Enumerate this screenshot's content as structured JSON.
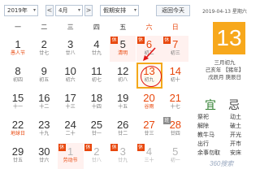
{
  "toolbar": {
    "year_value": "2019年",
    "prev_month": "<",
    "month_value": "4月",
    "next_month": ">",
    "holiday_select": "假期安排",
    "back_today": "返回今天"
  },
  "weekdays": [
    "一",
    "二",
    "三",
    "四",
    "五",
    "六",
    "日"
  ],
  "calendar": {
    "rows": [
      [
        {
          "day": "1",
          "lunar": "愚人节",
          "festival": true
        },
        {
          "day": "2",
          "lunar": "廿七"
        },
        {
          "day": "3",
          "lunar": "廿八"
        },
        {
          "day": "4",
          "lunar": "廿九"
        },
        {
          "day": "5",
          "lunar": "清明",
          "festival": true,
          "badge": "休",
          "holiday": true
        },
        {
          "day": "6",
          "lunar": "初二",
          "badge": "休",
          "holiday": true,
          "weekend": true
        },
        {
          "day": "7",
          "lunar": "初三",
          "badge": "休",
          "holiday": true,
          "weekend": true
        }
      ],
      [
        {
          "day": "8",
          "lunar": "初四"
        },
        {
          "day": "9",
          "lunar": "初五"
        },
        {
          "day": "10",
          "lunar": "初六"
        },
        {
          "day": "11",
          "lunar": "初七"
        },
        {
          "day": "12",
          "lunar": "初八"
        },
        {
          "day": "13",
          "lunar": "初九",
          "weekend": true,
          "today": true
        },
        {
          "day": "14",
          "lunar": "初十",
          "weekend": true
        }
      ],
      [
        {
          "day": "15",
          "lunar": "十一"
        },
        {
          "day": "16",
          "lunar": "十二"
        },
        {
          "day": "17",
          "lunar": "十三"
        },
        {
          "day": "18",
          "lunar": "十四"
        },
        {
          "day": "19",
          "lunar": "十五"
        },
        {
          "day": "20",
          "lunar": "谷雨",
          "festival": true,
          "weekend": true
        },
        {
          "day": "21",
          "lunar": "十七",
          "weekend": true
        }
      ],
      [
        {
          "day": "22",
          "lunar": "地球日",
          "festival": true
        },
        {
          "day": "23",
          "lunar": "十九"
        },
        {
          "day": "24",
          "lunar": "二十"
        },
        {
          "day": "25",
          "lunar": "廿一"
        },
        {
          "day": "26",
          "lunar": "廿二"
        },
        {
          "day": "27",
          "lunar": "廿三",
          "weekend": true
        },
        {
          "day": "28",
          "lunar": "廿四",
          "weekend": true,
          "badge": "班",
          "work": true
        }
      ],
      [
        {
          "day": "29",
          "lunar": "廿五"
        },
        {
          "day": "30",
          "lunar": "廿六"
        },
        {
          "day": "1",
          "lunar": "劳动节",
          "other": true,
          "festival": true,
          "badge": "休",
          "holiday": true
        },
        {
          "day": "2",
          "lunar": "廿八",
          "other": true,
          "badge": "休"
        },
        {
          "day": "3",
          "lunar": "廿九",
          "other": true,
          "badge": "休"
        },
        {
          "day": "4",
          "lunar": "三十",
          "other": true,
          "weekend": true,
          "badge": "休"
        },
        {
          "day": "5",
          "lunar": "初一",
          "other": true,
          "weekend": true
        }
      ]
    ]
  },
  "panel": {
    "date_line": "2019-04-13 星期六",
    "big_day": "13",
    "lunar_date": "三月初九",
    "ganzhi_year": "己亥年 【猪年】",
    "ganzhi_month_day": "戊辰月 庚辰日",
    "yi_title": "宜",
    "ji_title": "忌",
    "yi_items": [
      "祭祀",
      "解除",
      "教牛马",
      "出行",
      "余事勿取"
    ],
    "ji_items": [
      "动土",
      "破土",
      "开光",
      "开市",
      "安床"
    ]
  },
  "brand": "360搜索",
  "colors": {
    "accent": "#f7a81c",
    "weekend": "#e8470c",
    "today_ring": "#e01818",
    "yi": "#2d7d2d"
  }
}
